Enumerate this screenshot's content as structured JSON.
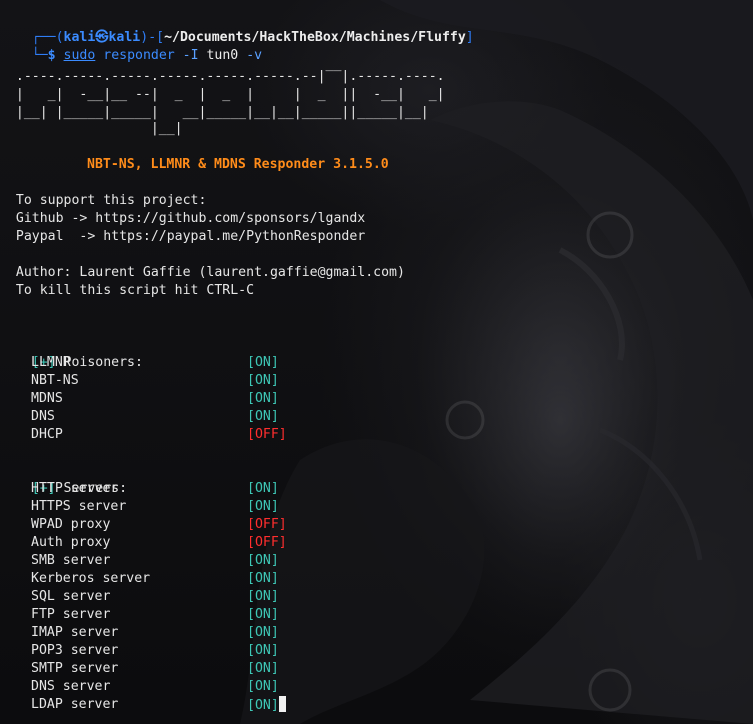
{
  "prompt": {
    "line1_prefix": "┌──(",
    "user": "kali",
    "at": "㉿",
    "host": "kali",
    "mid": ")-[",
    "path": "~/Documents/HackTheBox/Machines/Fluffy",
    "end": "]",
    "line2_prefix": "└─",
    "dollar": "$ ",
    "sudo": "sudo",
    "cmd": " responder",
    "args": " -I",
    "iface": " tun0",
    "flag": " -v"
  },
  "banner": [
    "                                         __",
    "  .----.-----.-----.-----.-----.-----.--|  |.-----.----.",
    "  |   _|  -__|__ --|  _  |  _  |     |  _  ||  -__|   _|",
    "  |__| |_____|_____|   __|_____|__|__|_____||_____|__|",
    "                   |__|"
  ],
  "title": "NBT-NS, LLMNR & MDNS Responder 3.1.5.0",
  "info": {
    "support": "  To support this project:",
    "github": "  Github -> https://github.com/sponsors/lgandx",
    "paypal": "  Paypal  -> https://paypal.me/PythonResponder",
    "author": "  Author: Laurent Gaffie (laurent.gaffie@gmail.com)",
    "kill": "  To kill this script hit CTRL-C"
  },
  "poisoners": {
    "marker": "[+]",
    "heading": " Poisoners:",
    "items": [
      {
        "name": "LLMNR",
        "status": "[ON]",
        "on": true
      },
      {
        "name": "NBT-NS",
        "status": "[ON]",
        "on": true
      },
      {
        "name": "MDNS",
        "status": "[ON]",
        "on": true
      },
      {
        "name": "DNS",
        "status": "[ON]",
        "on": true
      },
      {
        "name": "DHCP",
        "status": "[OFF]",
        "on": false
      }
    ]
  },
  "servers": {
    "marker": "[+]",
    "heading": " Servers:",
    "items": [
      {
        "name": "HTTP server",
        "status": "[ON]",
        "on": true
      },
      {
        "name": "HTTPS server",
        "status": "[ON]",
        "on": true
      },
      {
        "name": "WPAD proxy",
        "status": "[OFF]",
        "on": false
      },
      {
        "name": "Auth proxy",
        "status": "[OFF]",
        "on": false
      },
      {
        "name": "SMB server",
        "status": "[ON]",
        "on": true
      },
      {
        "name": "Kerberos server",
        "status": "[ON]",
        "on": true
      },
      {
        "name": "SQL server",
        "status": "[ON]",
        "on": true
      },
      {
        "name": "FTP server",
        "status": "[ON]",
        "on": true
      },
      {
        "name": "IMAP server",
        "status": "[ON]",
        "on": true
      },
      {
        "name": "POP3 server",
        "status": "[ON]",
        "on": true
      },
      {
        "name": "SMTP server",
        "status": "[ON]",
        "on": true
      },
      {
        "name": "DNS server",
        "status": "[ON]",
        "on": true
      },
      {
        "name": "LDAP server",
        "status": "[ON]",
        "on": true
      }
    ]
  },
  "colors": {
    "prompt_blue": "#2f7df6",
    "title_orange": "#ff8c1a",
    "status_on": "#3ec7b6",
    "status_off": "#ff2e2e",
    "background": "#0d0d0f"
  },
  "background_art": "dragon-wallpaper",
  "cursor": "block-cursor"
}
